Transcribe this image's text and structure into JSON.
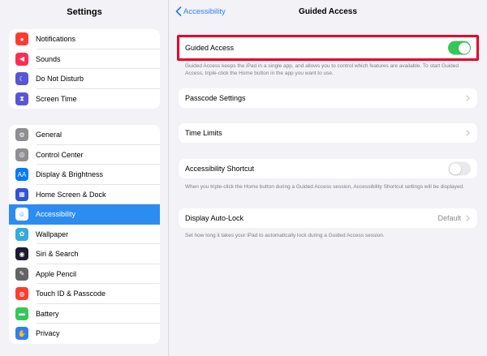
{
  "sidebar": {
    "title": "Settings",
    "group1": [
      {
        "label": "Notifications",
        "icon": "notifications-icon",
        "color": "#ff3b30",
        "glyph": "●"
      },
      {
        "label": "Sounds",
        "icon": "speaker-icon",
        "color": "#ff2d55",
        "glyph": "◀"
      },
      {
        "label": "Do Not Disturb",
        "icon": "moon-icon",
        "color": "#5856d6",
        "glyph": "☾"
      },
      {
        "label": "Screen Time",
        "icon": "hourglass-icon",
        "color": "#5856d6",
        "glyph": "⧗"
      }
    ],
    "group2": [
      {
        "label": "General",
        "icon": "gear-icon",
        "color": "#8e8e93",
        "glyph": "⚙"
      },
      {
        "label": "Control Center",
        "icon": "toggles-icon",
        "color": "#8e8e93",
        "glyph": "◎"
      },
      {
        "label": "Display & Brightness",
        "icon": "text-size-icon",
        "color": "#007aff",
        "glyph": "AA"
      },
      {
        "label": "Home Screen & Dock",
        "icon": "app-grid-icon",
        "color": "#2f55d4",
        "glyph": "▦"
      },
      {
        "label": "Accessibility",
        "icon": "accessibility-icon",
        "color": "#007aff",
        "glyph": "☺",
        "selected": true
      },
      {
        "label": "Wallpaper",
        "icon": "flower-icon",
        "color": "#35aadc",
        "glyph": "✿"
      },
      {
        "label": "Siri & Search",
        "icon": "siri-icon",
        "color": "#1c1c2e",
        "glyph": "◉"
      },
      {
        "label": "Apple Pencil",
        "icon": "pencil-icon",
        "color": "#636366",
        "glyph": "✎"
      },
      {
        "label": "Touch ID & Passcode",
        "icon": "fingerprint-icon",
        "color": "#ff3b30",
        "glyph": "◍"
      },
      {
        "label": "Battery",
        "icon": "battery-icon",
        "color": "#34c759",
        "glyph": "▬"
      },
      {
        "label": "Privacy",
        "icon": "hand-icon",
        "color": "#2f7ff0",
        "glyph": "✋"
      }
    ]
  },
  "nav": {
    "back_label": "Accessibility",
    "title": "Guided Access"
  },
  "guided_access": {
    "label": "Guided Access",
    "enabled": true,
    "description": "Guided Access keeps the iPad in a single app, and allows you to control which features are available. To start Guided Access, triple-click the Home button in the app you want to use."
  },
  "passcode_settings": {
    "label": "Passcode Settings"
  },
  "time_limits": {
    "label": "Time Limits"
  },
  "accessibility_shortcut": {
    "label": "Accessibility Shortcut",
    "enabled": false,
    "description": "When you triple-click the Home button during a Guided Access session, Accessibility Shortcut settings will be displayed."
  },
  "display_auto_lock": {
    "label": "Display Auto-Lock",
    "value": "Default",
    "description": "Set how long it takes your iPad to automatically lock during a Guided Access session."
  },
  "colors": {
    "accent": "#007aff",
    "selected_row": "#2d8cf0",
    "toggle_on": "#34c759",
    "highlight_border": "#e8002a"
  }
}
